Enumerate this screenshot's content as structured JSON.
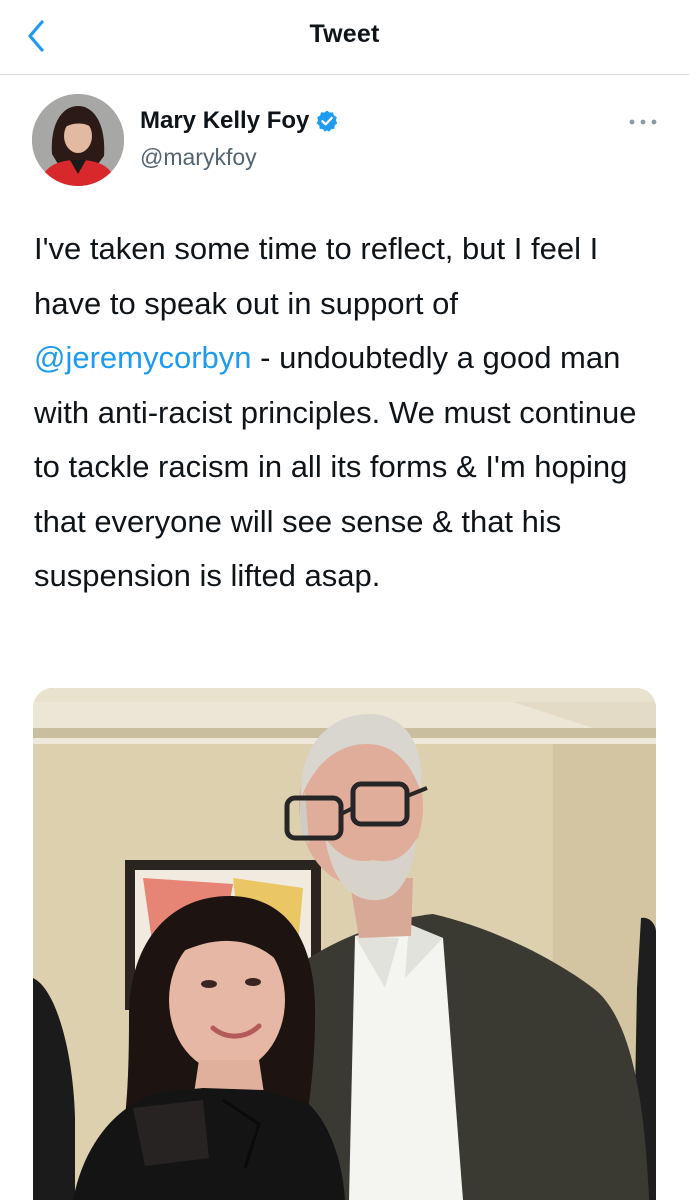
{
  "header": {
    "title": "Tweet",
    "back_icon": "chevron-left-icon"
  },
  "tweet": {
    "author": {
      "display_name": "Mary Kelly Foy",
      "handle": "@marykfoy",
      "verified": true,
      "verified_color": "#1d9bf0"
    },
    "more_icon": "more-horizontal-icon",
    "text_segments": [
      {
        "type": "text",
        "value": "I've taken some time to reflect, but I feel I have to speak out in support of "
      },
      {
        "type": "mention",
        "value": "@jeremycorbyn"
      },
      {
        "type": "text",
        "value": " - undoubtedly a good man with anti-racist principles. We must continue to tackle racism in all its forms & I'm hoping that everyone will see sense & that his suspension is lifted asap."
      }
    ],
    "media": {
      "kind": "photo"
    }
  },
  "colors": {
    "link": "#1d9bf0",
    "text": "#0f1419",
    "secondary_text": "#536471",
    "divider": "#d9d9d9"
  }
}
